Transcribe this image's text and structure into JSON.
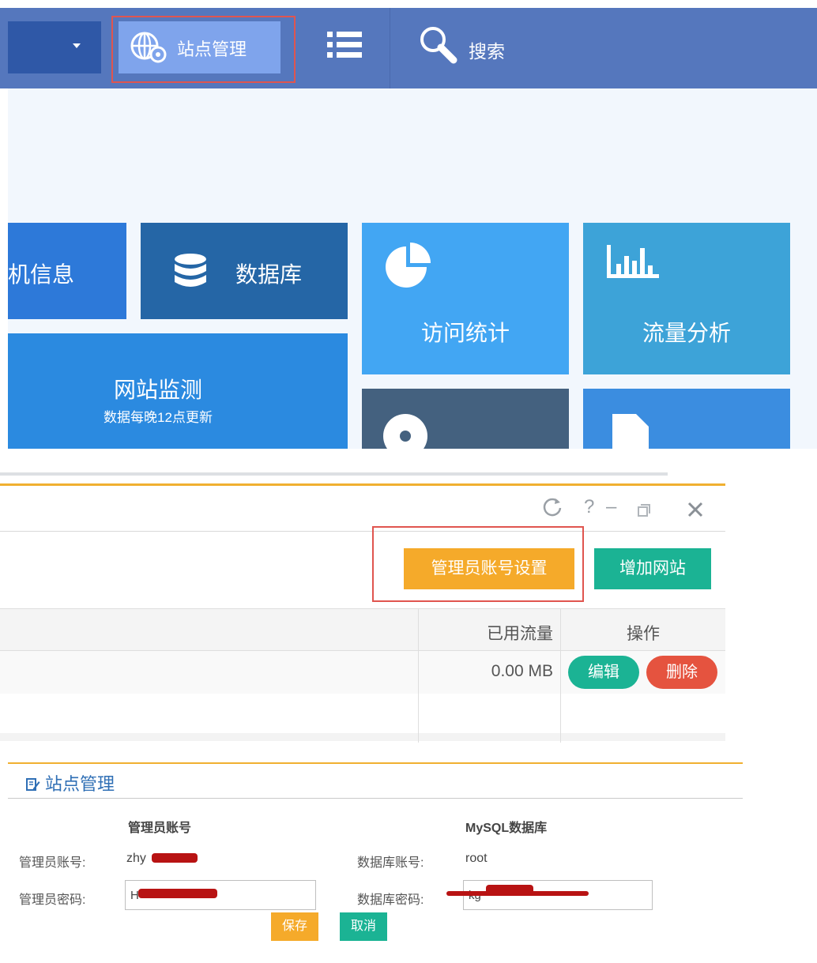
{
  "topnav": {
    "site_manage": "站点管理",
    "search": "搜索"
  },
  "tiles": {
    "host_info": "主机信息",
    "database": "数据库",
    "visit_stats": "访问统计",
    "traffic_analysis": "流量分析",
    "site_monitor": "网站监测",
    "site_monitor_sub": "数据每晚12点更新"
  },
  "window": {
    "controls": [
      "refresh-icon",
      "help-icon",
      "minimize-icon",
      "restore-icon",
      "close-icon"
    ],
    "admin_account_button": "管理员账号设置",
    "add_site_button": "增加网站",
    "table": {
      "columns": [
        "已用流量",
        "操作"
      ],
      "rows": [
        {
          "used_traffic": "0.00 MB",
          "edit": "编辑",
          "delete": "删除"
        }
      ]
    }
  },
  "form": {
    "title": "站点管理",
    "admin_section": "管理员账号",
    "mysql_section": "MySQL数据库",
    "admin_account_label": "管理员账号:",
    "admin_account_value": "zhy",
    "admin_password_label": "管理员密码:",
    "admin_password_value": "H",
    "db_account_label": "数据库账号:",
    "db_account_value": "root",
    "db_password_label": "数据库密码:",
    "db_password_value": "kg",
    "save": "保存",
    "cancel": "取消"
  },
  "colors": {
    "nav_bg": "#5577bd",
    "accent_orange": "#f5aa2a",
    "accent_green": "#1bb394",
    "danger_red": "#e5533f",
    "highlight_box": "#e0554f"
  }
}
